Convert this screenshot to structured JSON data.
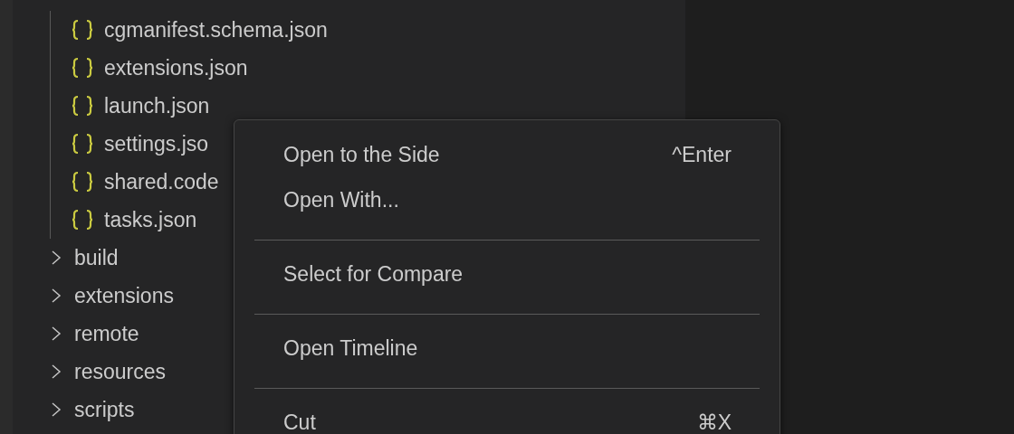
{
  "explorer": {
    "files": [
      {
        "label": "cgmanifest.schema.json"
      },
      {
        "label": "extensions.json"
      },
      {
        "label": "launch.json"
      },
      {
        "label": "settings.jso"
      },
      {
        "label": "shared.code"
      },
      {
        "label": "tasks.json"
      }
    ],
    "folders": [
      {
        "label": "build",
        "expanded": false
      },
      {
        "label": "extensions",
        "expanded": false
      },
      {
        "label": "remote",
        "expanded": false
      },
      {
        "label": "resources",
        "expanded": false
      },
      {
        "label": "scripts",
        "expanded": false
      }
    ]
  },
  "context_menu": {
    "items": [
      {
        "kind": "item",
        "label": "Open to the Side",
        "shortcut": "^Enter"
      },
      {
        "kind": "item",
        "label": "Open With..."
      },
      {
        "kind": "separator"
      },
      {
        "kind": "item",
        "label": "Select for Compare"
      },
      {
        "kind": "separator"
      },
      {
        "kind": "item",
        "label": "Open Timeline"
      },
      {
        "kind": "separator"
      },
      {
        "kind": "item",
        "label": "Cut",
        "shortcut": "⌘X"
      }
    ]
  }
}
